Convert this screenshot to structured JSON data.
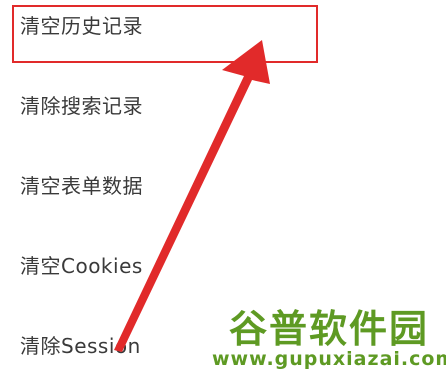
{
  "menu": {
    "items": [
      {
        "label": "清空历史记录"
      },
      {
        "label": "清除搜索记录"
      },
      {
        "label": "清空表单数据"
      },
      {
        "label": "清空Cookies"
      },
      {
        "label": "清除Session"
      }
    ]
  },
  "watermark": {
    "title": "谷普软件园",
    "url": "www.gupuxiazai.com"
  },
  "colors": {
    "annotation": "#e12a2a",
    "watermark": "#5e9a23",
    "text": "#3a3a3a"
  }
}
